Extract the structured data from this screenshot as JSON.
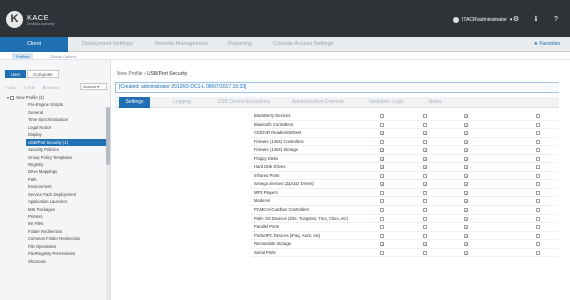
{
  "header": {
    "logo_letter": "K",
    "brand": "KACE",
    "brand_sub": "Desktop Authority",
    "user": "ITACR\\administrator",
    "icons": [
      "gear-icon",
      "info-icon",
      "question-icon"
    ]
  },
  "nav": {
    "items": [
      "Client Configuration",
      "Deployment Settings",
      "Remote Management",
      "Reporting",
      "Console Access Settings"
    ],
    "favorites": "Favorites"
  },
  "subnav": {
    "items": [
      "Profiles",
      "Global Options"
    ]
  },
  "left_panel": {
    "tabs": [
      "User",
      "Computer"
    ],
    "tools": [
      "+ Add",
      "✎ Edit",
      "✖ Delete"
    ],
    "actions_label": "Actions ▾",
    "tree": [
      "New Profile (2)",
      "Pre-Engine Scripts",
      "General",
      "Time Synchronization",
      "Legal Notice",
      "Display",
      "USB/Port Security (1)",
      "Security Policies",
      "Group Policy Templates",
      "Registry",
      "Drive Mappings",
      "Path",
      "Environment",
      "Service Pack Deployment",
      "Application Launcher",
      "MSI Packages",
      "Printers",
      "INI Files",
      "Folder Redirection",
      "Common Folder Redirection",
      "File Operations",
      "File/Registry Permissions",
      "Shortcuts"
    ],
    "selected_index": 6
  },
  "main": {
    "breadcrumb_parent": "New Profile",
    "breadcrumb_sep": "›",
    "breadcrumb_current": "USB/Port Security",
    "created": "[Created: administrator 2012R2-DC1-L 08/07/2017 15:33]",
    "tabs": [
      "Settings",
      "Logging",
      "USB Device Exceptions",
      "Administrative Override",
      "Validation Logic",
      "Notes"
    ]
  },
  "devices": [
    {
      "name": "BlackBerry Devices",
      "c1": false,
      "c2": false,
      "c3": true,
      "c4": false
    },
    {
      "name": "Bluetooth Controllers",
      "c1": false,
      "c2": false,
      "c3": true,
      "c4": false
    },
    {
      "name": "CD/DVD Readers/Writers",
      "c1": true,
      "c2": true,
      "c3": true,
      "c4": false
    },
    {
      "name": "Firewire (1394) Controllers",
      "c1": false,
      "c2": false,
      "c3": true,
      "c4": false
    },
    {
      "name": "Firewire (1394) Storage",
      "c1": true,
      "c2": true,
      "c3": true,
      "c4": false
    },
    {
      "name": "Floppy Disks",
      "c1": true,
      "c2": true,
      "c3": true,
      "c4": false
    },
    {
      "name": "Hard Disk Drives",
      "c1": true,
      "c2": true,
      "c3": true,
      "c4": false
    },
    {
      "name": "Infrared Ports",
      "c1": false,
      "c2": false,
      "c3": true,
      "c4": false
    },
    {
      "name": "Iomega devices (Zip/Jaz Drives)",
      "c1": true,
      "c2": true,
      "c3": true,
      "c4": false
    },
    {
      "name": "MP3 Players",
      "c1": false,
      "c2": false,
      "c3": true,
      "c4": false
    },
    {
      "name": "Modems",
      "c1": false,
      "c2": false,
      "c3": true,
      "c4": false
    },
    {
      "name": "PCMCIA/Cardbus Controllers",
      "c1": false,
      "c2": false,
      "c3": true,
      "c4": false
    },
    {
      "name": "Palm OS Devices (Zire, Tungsten, Treo, Clieo, etc)",
      "c1": false,
      "c2": false,
      "c3": true,
      "c4": false
    },
    {
      "name": "Parallel Ports",
      "c1": false,
      "c2": false,
      "c3": true,
      "c4": false
    },
    {
      "name": "PocketPC Devices (iPaq, Axim, etc)",
      "c1": false,
      "c2": false,
      "c3": true,
      "c4": false
    },
    {
      "name": "Removable Storage",
      "c1": true,
      "c2": true,
      "c3": true,
      "c4": false
    },
    {
      "name": "Serial Ports",
      "c1": false,
      "c2": false,
      "c3": true,
      "c4": false
    }
  ],
  "colors": {
    "topbar": "#2f3338",
    "accent": "#1f6fb2"
  }
}
